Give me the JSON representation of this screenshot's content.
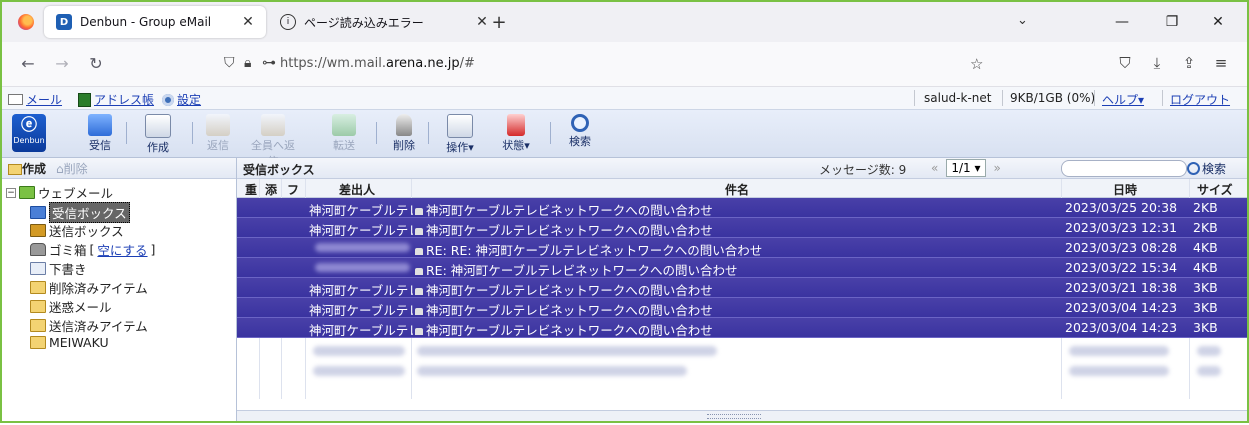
{
  "browser": {
    "tabs": [
      {
        "title": "Denbun - Group eMail",
        "active": true
      },
      {
        "title": "ページ読み込みエラー",
        "active": false
      }
    ],
    "new_tab": "+",
    "list_all": "⌄",
    "window_controls": [
      "—",
      "❐",
      "✕"
    ],
    "url_prefix": "https://wm.mail.",
    "url_host": "arena.ne.jp",
    "url_suffix": "/#"
  },
  "appmenu": {
    "mail": "メール",
    "address_book": "アドレス帳",
    "settings": "設定",
    "account": "salud-k-net",
    "quota": "9KB/1GB (0%)",
    "help": "ヘルプ▾",
    "logout": "ログアウト"
  },
  "toolbar": {
    "logo": "Denbun",
    "buttons": [
      {
        "label": "受信",
        "icon": "receive-icon",
        "enabled": true
      },
      {
        "label": "作成",
        "icon": "compose-icon",
        "enabled": true
      },
      {
        "label": "返信",
        "icon": "reply-icon",
        "enabled": false
      },
      {
        "label": "全員へ返信",
        "icon": "reply-all-icon",
        "enabled": false
      },
      {
        "label": "転送",
        "icon": "forward-icon",
        "enabled": false
      },
      {
        "label": "削除",
        "icon": "trash-icon",
        "enabled": true
      },
      {
        "label": "操作▾",
        "icon": "operation-icon",
        "enabled": true
      },
      {
        "label": "状態▾",
        "icon": "flag-icon",
        "enabled": true
      },
      {
        "label": "検索",
        "icon": "search-icon",
        "enabled": true
      }
    ]
  },
  "folders": {
    "create": "作成",
    "delete": "削除",
    "root": "ウェブメール",
    "items": [
      {
        "label": "受信ボックス",
        "selected": true
      },
      {
        "label": "送信ボックス"
      },
      {
        "label": "ゴミ箱",
        "extra_link": "空にする"
      },
      {
        "label": "下書き"
      },
      {
        "label": "削除済みアイテム"
      },
      {
        "label": "迷惑メール"
      },
      {
        "label": "送信済みアイテム"
      },
      {
        "label": "MEIWAKU"
      }
    ]
  },
  "list": {
    "title": "受信ボックス",
    "message_count": "メッセージ数: 9",
    "page_prev": "«",
    "page": "1/1 ▾",
    "page_next": "»",
    "search_button": "検索",
    "columns": {
      "priority": "重",
      "attachment": "添",
      "flag": "フ",
      "from": "差出人",
      "subject": "件名",
      "date": "日時",
      "size": "サイズ"
    },
    "rows": [
      {
        "from": "神河町ケーブルテレ",
        "subject": "神河町ケーブルテレビネットワークへの問い合わせ",
        "date": "2023/03/25 20:38",
        "size": "2KB"
      },
      {
        "from": "神河町ケーブルテレ",
        "subject": "神河町ケーブルテレビネットワークへの問い合わせ",
        "date": "2023/03/23 12:31",
        "size": "2KB"
      },
      {
        "from": "",
        "subject": "RE: RE: 神河町ケーブルテレビネットワークへの問い合わせ",
        "date": "2023/03/23 08:28",
        "size": "4KB"
      },
      {
        "from": "",
        "subject": "RE: 神河町ケーブルテレビネットワークへの問い合わせ",
        "date": "2023/03/22 15:34",
        "size": "4KB"
      },
      {
        "from": "神河町ケーブルテレ",
        "subject": "神河町ケーブルテレビネットワークへの問い合わせ",
        "date": "2023/03/21 18:38",
        "size": "3KB"
      },
      {
        "from": "神河町ケーブルテレ",
        "subject": "神河町ケーブルテレビネットワークへの問い合わせ",
        "date": "2023/03/04 14:23",
        "size": "3KB"
      },
      {
        "from": "神河町ケーブルテレ",
        "subject": "神河町ケーブルテレビネットワークへの問い合わせ",
        "date": "2023/03/04 14:23",
        "size": "3KB"
      }
    ]
  }
}
